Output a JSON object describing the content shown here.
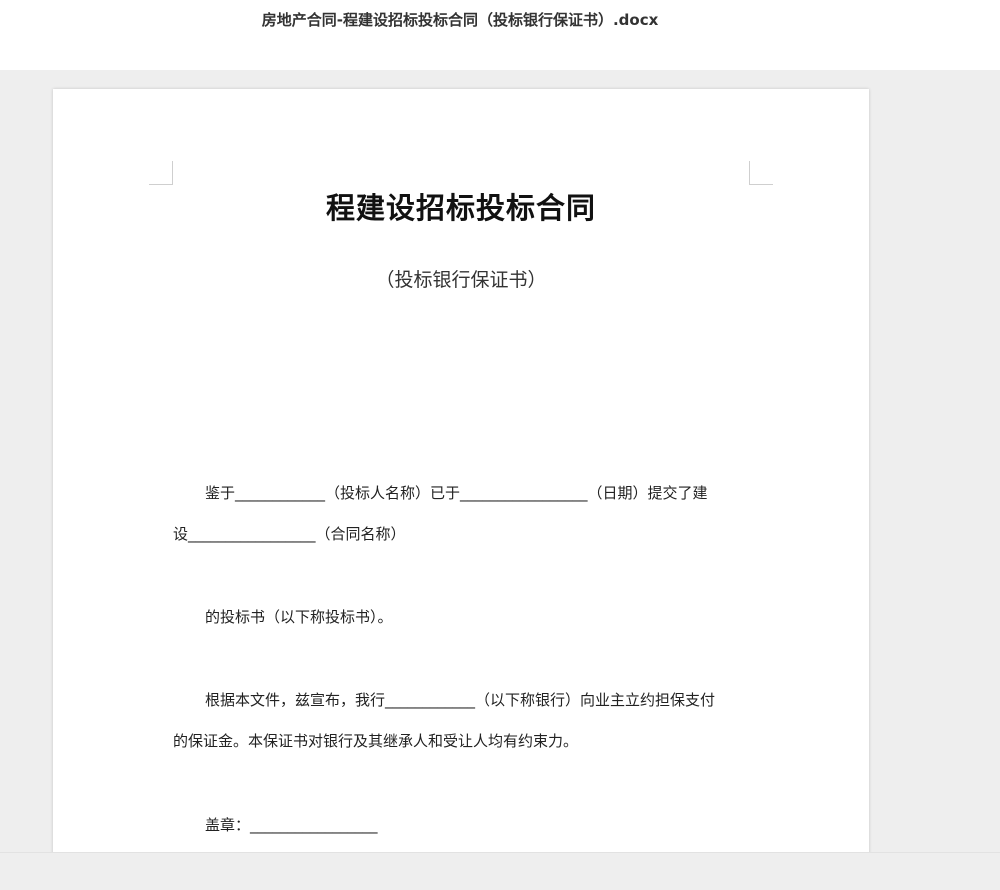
{
  "window": {
    "filename": "房地产合同-程建设招标投标合同（投标银行保证书）.docx"
  },
  "document": {
    "title": "程建设招标投标合同",
    "subtitle": "（投标银行保证书）",
    "paragraphs": {
      "p1_line1": "鉴于____________（投标人名称）已于_________________（日期）提交了建",
      "p1_line2": "设_________________（合同名称）",
      "p2": "的投标书（以下称投标书）。",
      "p3_line1": "根据本文件，兹宣布，我行____________（以下称银行）向业主立约担保支付",
      "p3_line2": "的保证金。本保证书对银行及其继承人和受让人均有约束力。",
      "p4": "盖章：_________________"
    }
  }
}
